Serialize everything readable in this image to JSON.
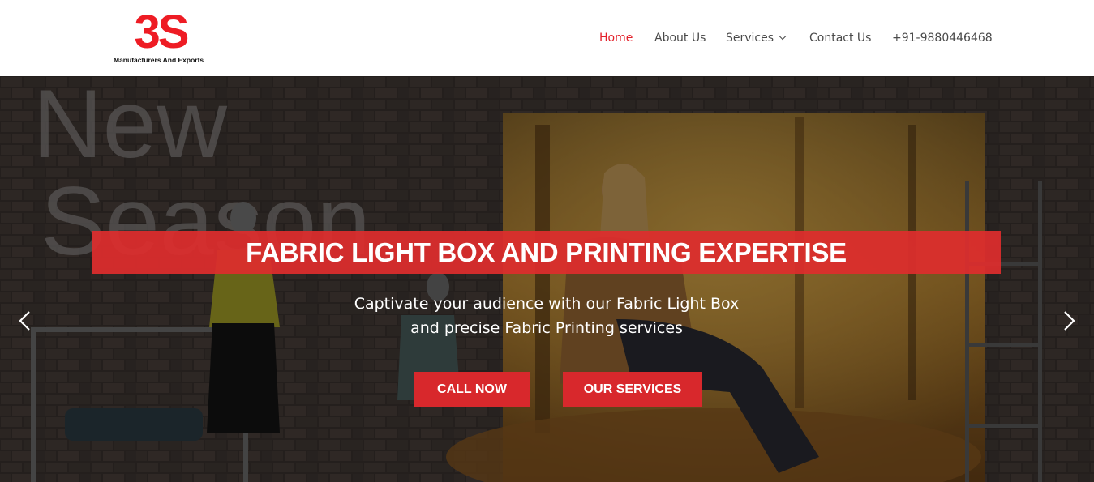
{
  "brand": {
    "logo_mark": "3S",
    "tagline": "Manufacturers And Exports",
    "accent_color": "#e3202a"
  },
  "nav": {
    "items": [
      {
        "label": "Home",
        "active": true
      },
      {
        "label": "About Us"
      },
      {
        "label": "Services",
        "has_dropdown": true
      },
      {
        "label": "Contact Us"
      },
      {
        "label": "+91-9880446468"
      }
    ]
  },
  "hero": {
    "title": "FABRIC LIGHT BOX AND PRINTING EXPERTISE",
    "subtitle_line1": "Captivate your audience with our Fabric Light Box",
    "subtitle_line2": "and precise Fabric Printing services",
    "wall_text_line1": "New",
    "wall_text_line2": "Season",
    "buttons": {
      "call": "CALL NOW",
      "services": "OUR SERVICES"
    },
    "button_color": "#d8282c",
    "icons": {
      "prev": "chevron-left-icon",
      "next": "chevron-right-icon"
    }
  }
}
